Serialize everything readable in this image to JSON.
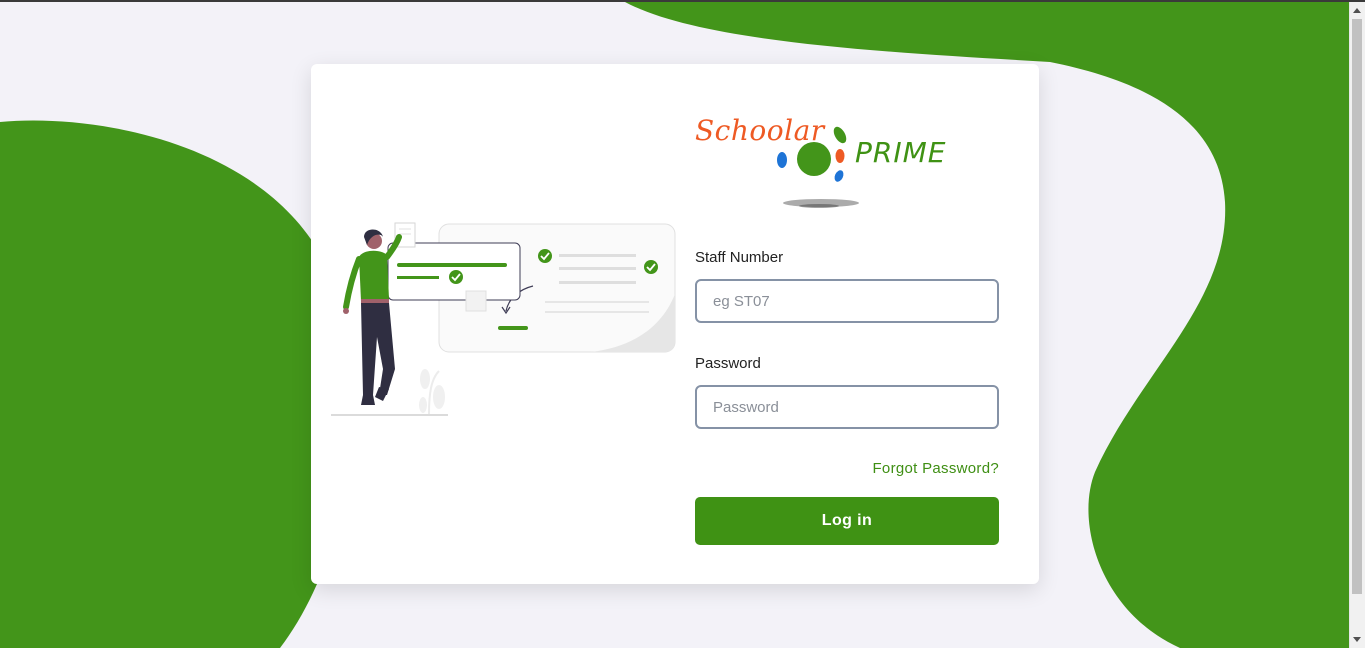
{
  "colors": {
    "accent": "#3f9214",
    "background": "#f3f2f8",
    "card": "#ffffff",
    "logo_orange": "#ee5a24",
    "input_border": "#8592a6"
  },
  "logo": {
    "word1": "Schoolar",
    "word2": "PRIME"
  },
  "form": {
    "staff_label": "Staff Number",
    "staff_placeholder": "eg ST07",
    "password_label": "Password",
    "password_placeholder": "Password",
    "forgot_label": "Forgot Password?",
    "login_label": "Log in"
  }
}
